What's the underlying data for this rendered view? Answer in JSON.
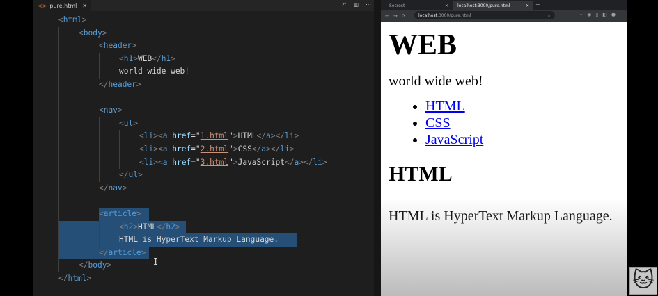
{
  "editor": {
    "tab_label": "pure.html",
    "tab_icon": "html-file-icon",
    "close_glyph": "✕",
    "action_icons": [
      "⎇",
      "▥",
      "⋯"
    ],
    "lines": [
      {
        "tokens": [
          [
            "br",
            "<"
          ],
          [
            "tag",
            "html"
          ],
          [
            "br",
            ">"
          ]
        ]
      },
      {
        "tokens": [
          [
            "br",
            "<"
          ],
          [
            "tag",
            "body"
          ],
          [
            "br",
            ">"
          ]
        ]
      },
      {
        "tokens": [
          [
            "br",
            "<"
          ],
          [
            "tag",
            "header"
          ],
          [
            "br",
            ">"
          ]
        ]
      },
      {
        "tokens": [
          [
            "br",
            "<"
          ],
          [
            "tag",
            "h1"
          ],
          [
            "br",
            ">"
          ],
          [
            "txt",
            "WEB"
          ],
          [
            "br",
            "</"
          ],
          [
            "tag",
            "h1"
          ],
          [
            "br",
            ">"
          ]
        ]
      },
      {
        "tokens": [
          [
            "txt",
            "world wide web!"
          ]
        ]
      },
      {
        "tokens": [
          [
            "br",
            "</"
          ],
          [
            "tag",
            "header"
          ],
          [
            "br",
            ">"
          ]
        ]
      },
      {
        "tokens": []
      },
      {
        "tokens": [
          [
            "br",
            "<"
          ],
          [
            "tag",
            "nav"
          ],
          [
            "br",
            ">"
          ]
        ]
      },
      {
        "tokens": [
          [
            "br",
            "<"
          ],
          [
            "tag",
            "ul"
          ],
          [
            "br",
            ">"
          ]
        ]
      },
      {
        "tokens": [
          [
            "br",
            "<"
          ],
          [
            "tag",
            "li"
          ],
          [
            "br",
            "><"
          ],
          [
            "tag",
            "a"
          ],
          [
            "txt",
            " "
          ],
          [
            "attr",
            "href"
          ],
          [
            "txt",
            "="
          ],
          [
            "txt",
            "\""
          ],
          [
            "str",
            "1.html"
          ],
          [
            "txt",
            "\""
          ],
          [
            "br",
            ">"
          ],
          [
            "txt",
            "HTML"
          ],
          [
            "br",
            "</"
          ],
          [
            "tag",
            "a"
          ],
          [
            "br",
            "></"
          ],
          [
            "tag",
            "li"
          ],
          [
            "br",
            ">"
          ]
        ]
      },
      {
        "tokens": [
          [
            "br",
            "<"
          ],
          [
            "tag",
            "li"
          ],
          [
            "br",
            "><"
          ],
          [
            "tag",
            "a"
          ],
          [
            "txt",
            " "
          ],
          [
            "attr",
            "href"
          ],
          [
            "txt",
            "="
          ],
          [
            "txt",
            "\""
          ],
          [
            "str",
            "2.html"
          ],
          [
            "txt",
            "\""
          ],
          [
            "br",
            ">"
          ],
          [
            "txt",
            "CSS"
          ],
          [
            "br",
            "</"
          ],
          [
            "tag",
            "a"
          ],
          [
            "br",
            "></"
          ],
          [
            "tag",
            "li"
          ],
          [
            "br",
            ">"
          ]
        ]
      },
      {
        "tokens": [
          [
            "br",
            "<"
          ],
          [
            "tag",
            "li"
          ],
          [
            "br",
            "><"
          ],
          [
            "tag",
            "a"
          ],
          [
            "txt",
            " "
          ],
          [
            "attr",
            "href"
          ],
          [
            "txt",
            "="
          ],
          [
            "txt",
            "\""
          ],
          [
            "str",
            "3.html"
          ],
          [
            "txt",
            "\""
          ],
          [
            "br",
            ">"
          ],
          [
            "txt",
            "JavaScript"
          ],
          [
            "br",
            "</"
          ],
          [
            "tag",
            "a"
          ],
          [
            "br",
            "></"
          ],
          [
            "tag",
            "li"
          ],
          [
            "br",
            ">"
          ]
        ]
      },
      {
        "tokens": [
          [
            "br",
            "</"
          ],
          [
            "tag",
            "ul"
          ],
          [
            "br",
            ">"
          ]
        ]
      },
      {
        "tokens": [
          [
            "br",
            "</"
          ],
          [
            "tag",
            "nav"
          ],
          [
            "br",
            ">"
          ]
        ]
      },
      {
        "tokens": []
      },
      {
        "tokens": [
          [
            "br",
            "<"
          ],
          [
            "tag",
            "article"
          ],
          [
            "br",
            ">"
          ]
        ]
      },
      {
        "tokens": [
          [
            "br",
            "<"
          ],
          [
            "tag",
            "h2"
          ],
          [
            "br",
            ">"
          ],
          [
            "txt",
            "HTML"
          ],
          [
            "br",
            "</"
          ],
          [
            "tag",
            "h2"
          ],
          [
            "br",
            ">"
          ]
        ]
      },
      {
        "tokens": [
          [
            "txt",
            "HTML is HyperText Markup Language."
          ]
        ]
      },
      {
        "tokens": [
          [
            "br",
            "</"
          ],
          [
            "tag",
            "article"
          ],
          [
            "br",
            ">"
          ]
        ]
      },
      {
        "tokens": [
          [
            "br",
            "</"
          ],
          [
            "tag",
            "body"
          ],
          [
            "br",
            ">"
          ]
        ]
      },
      {
        "tokens": [
          [
            "br",
            "</"
          ],
          [
            "tag",
            "html"
          ],
          [
            "br",
            ">"
          ]
        ]
      }
    ]
  },
  "browser": {
    "tabs": [
      {
        "label": "Secrest",
        "close": "✕"
      },
      {
        "label": "localhost:3000/pure.html",
        "close": "✕"
      }
    ],
    "new_tab": "+",
    "nav_back": "←",
    "nav_forward": "→",
    "nav_reload": "⟳",
    "url_host": "localhost",
    "url_path": ":3000/pure.html",
    "star": "☆",
    "toolbar_icons": [
      "🔍",
      "☆",
      "⋯",
      "◉",
      "▯",
      "◧",
      "●",
      "⋮"
    ],
    "page": {
      "h1": "WEB",
      "paragraph": "world wide web!",
      "links": [
        "HTML",
        "CSS",
        "JavaScript"
      ],
      "h2": "HTML",
      "article_text": "HTML is HyperText Markup Language."
    }
  },
  "colors": {
    "editor_bg": "#1e1e1e",
    "tag": "#569cd6",
    "attr": "#9cdcfe",
    "string": "#ce9178",
    "selection": "#264f78"
  }
}
